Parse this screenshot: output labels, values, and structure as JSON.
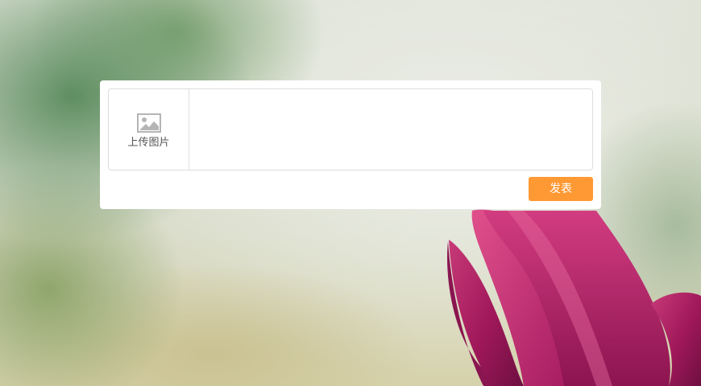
{
  "composer": {
    "upload_label": "上传图片",
    "upload_icon": "image-icon",
    "text_value": "",
    "text_placeholder": ""
  },
  "actions": {
    "publish_label": "发表"
  },
  "colors": {
    "accent": "#ff9933",
    "card": "#ffffff",
    "border": "#dcdcdc",
    "icon": "#b5b5b5"
  }
}
